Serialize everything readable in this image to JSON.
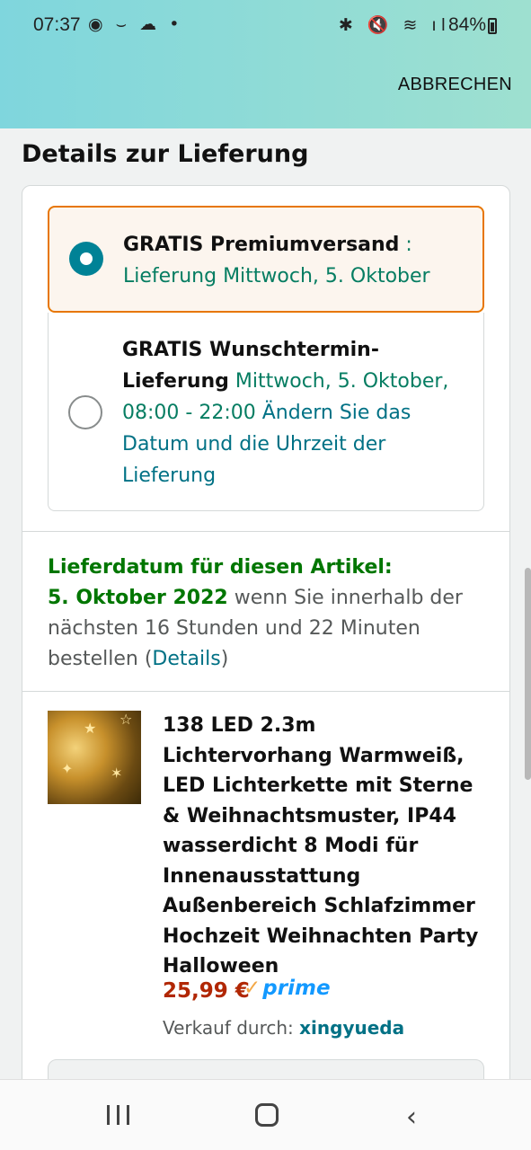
{
  "status_bar": {
    "time": "07:37",
    "left_icons": "◉ ⌣ ☁ •",
    "right_icons": "✱ 🔇 ≋ ıl",
    "battery": "84%"
  },
  "header": {
    "cancel_label": "ABBRECHEN"
  },
  "section_title": "Details zur Lieferung",
  "shipping_options": [
    {
      "selected": true,
      "name": "GRATIS Premiumversand",
      "separator": " : ",
      "delivery": "Lieferung Mittwoch, 5. Oktober"
    },
    {
      "selected": false,
      "name": "GRATIS Wunschtermin-Lieferung",
      "delivery": "Mittwoch, 5. Oktober, 08:00 - 22:00",
      "change_link": "Ändern Sie das Datum und die Uhrzeit der Lieferung"
    }
  ],
  "delivery_info": {
    "heading": "Lieferdatum für diesen Artikel:",
    "date": "5. Oktober 2022",
    "condition": " wenn Sie innerhalb der nächsten 16 Stunden und 22 Minuten bestellen (",
    "details_link": "Details",
    "close_paren": ")"
  },
  "product": {
    "title": "138 LED 2.3m Lichtervorhang Warmweiß, LED Lichterkette mit Sterne & Weihnachtsmuster, IP44 wasserdicht 8 Modi für Innenausstattung Außenbereich Schlafzimmer Hochzeit Weihnachten Party Halloween",
    "price": "25,99 €",
    "prime_label": "prime",
    "seller_label": "Verkauf durch: ",
    "seller_name": "xingyueda"
  },
  "colors": {
    "accent_orange": "#e77600",
    "radio_teal": "#008296",
    "link_teal": "#007185",
    "green": "#067d62",
    "price_red": "#b12704",
    "prime_blue": "#1399ff"
  }
}
